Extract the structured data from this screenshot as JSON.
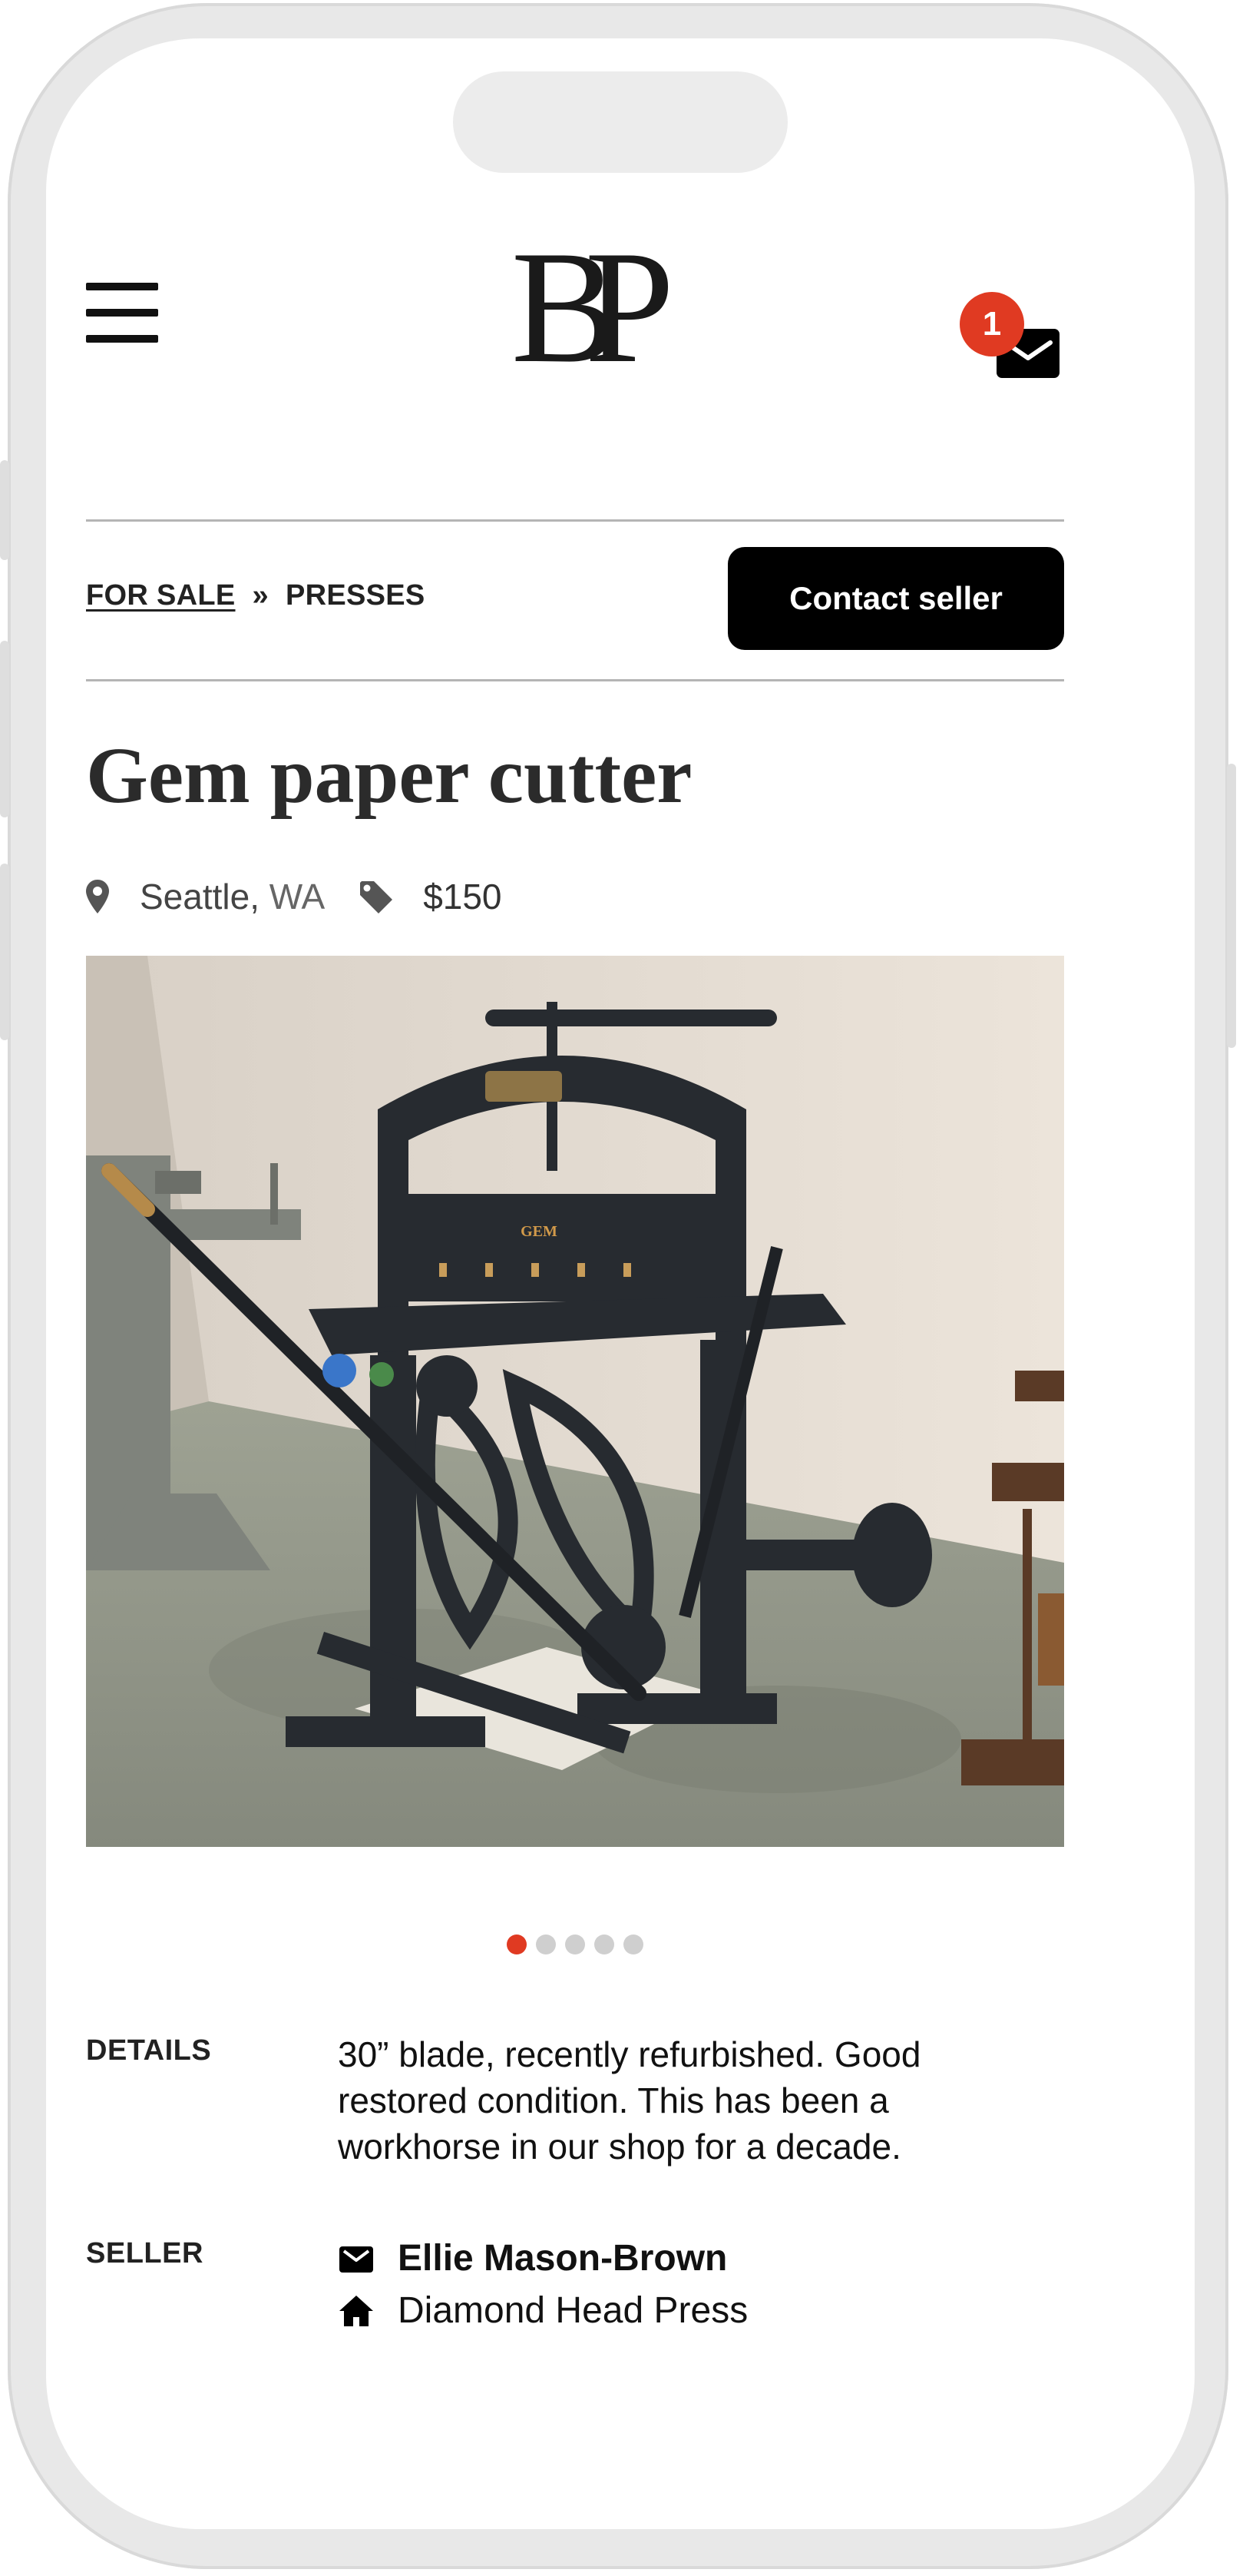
{
  "header": {
    "logo_text": "BP",
    "unread_count": "1"
  },
  "breadcrumb": {
    "parent": "FOR SALE",
    "separator": "»",
    "current": "PRESSES"
  },
  "contact_button": "Contact seller",
  "listing": {
    "title": "Gem paper cutter",
    "city": "Seattle,",
    "state": "WA",
    "price": "$150",
    "photo_label": "GEM",
    "carousel_count": 5,
    "carousel_active": 1
  },
  "details": {
    "label": "DETAILS",
    "text": "30” blade, recently refurbished. Good restored condition. This has been a workhorse in our shop for a decade."
  },
  "seller": {
    "label": "SELLER",
    "name": "Ellie Mason-Brown",
    "shop": "Diamond Head Press"
  },
  "colors": {
    "accent": "#e03a22",
    "button": "#000000",
    "text": "#222222"
  },
  "icons": {
    "menu": "hamburger-icon",
    "mail": "envelope-icon",
    "location": "map-pin-icon",
    "price": "tag-icon",
    "seller_mail": "envelope-icon",
    "shop": "home-icon"
  }
}
